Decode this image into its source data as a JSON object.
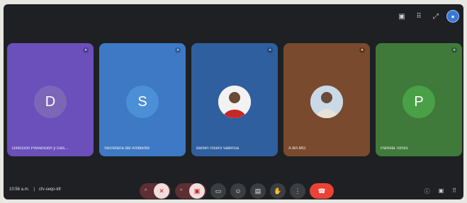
{
  "meeting": {
    "time": "10:56 a.m.",
    "separator": "|",
    "code": "cfv-seqo-kfr"
  },
  "participants": [
    {
      "name": "Dirección Prevención y Ges...",
      "initial": "D",
      "color": "#6b4fbb",
      "avatar_color": "#7b66b8"
    },
    {
      "name": "Secretaría del Ambiente",
      "initial": "S",
      "color": "#3d79c4",
      "avatar_color": "#4b8fd6"
    },
    {
      "name": "darwin rosero valencia",
      "initial": "",
      "color": "#2f5f9e",
      "avatar_color": ""
    },
    {
      "name": "A BA MO",
      "initial": "",
      "color": "#7a4a2e",
      "avatar_color": ""
    },
    {
      "name": "Pamela Torres",
      "initial": "P",
      "color": "#3f7a3a",
      "avatar_color": "#4aa046"
    }
  ],
  "icons": {
    "top": [
      "pin-icon",
      "apps-icon",
      "expand-icon",
      "avatar-icon"
    ],
    "controls": [
      "mic-off-icon",
      "camera-off-icon",
      "present-icon",
      "emoji-icon",
      "captions-icon",
      "raise-hand-icon",
      "more-icon",
      "hangup-icon"
    ],
    "right": [
      "info-icon",
      "chat-icon",
      "activities-icon"
    ]
  }
}
